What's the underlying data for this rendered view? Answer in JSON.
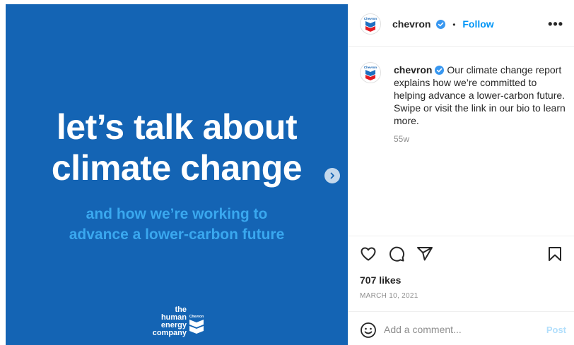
{
  "post": {
    "headline": [
      "let’s talk about",
      "climate change"
    ],
    "subline": [
      "and how we’re working to",
      "advance a lower-carbon future"
    ],
    "brand_tagline": [
      "the",
      "human",
      "energy",
      "company"
    ],
    "brand_logo_word": "Chevron",
    "colors": {
      "background": "#1464b4",
      "headline": "#ffffff",
      "subline": "#3aa8ef"
    }
  },
  "header": {
    "username": "chevron",
    "separator": "•",
    "follow_label": "Follow",
    "more_label": "•••",
    "avatar_logo_word": "Chevron"
  },
  "caption": {
    "username": "chevron",
    "text": "Our climate change report explains how we’re committed to helping advance a lower-carbon future. Swipe or visit the link in our bio to learn more.",
    "time_ago": "55w"
  },
  "actions": {
    "icons": [
      "heart-icon",
      "comment-icon",
      "share-icon",
      "bookmark-icon"
    ]
  },
  "likes": "707 likes",
  "date": "MARCH 10, 2021",
  "comment": {
    "placeholder": "Add a comment...",
    "post_label": "Post",
    "post_color": "#b2dffc"
  },
  "colors": {
    "accent": "#0095f6",
    "verified": "#3897f0"
  }
}
